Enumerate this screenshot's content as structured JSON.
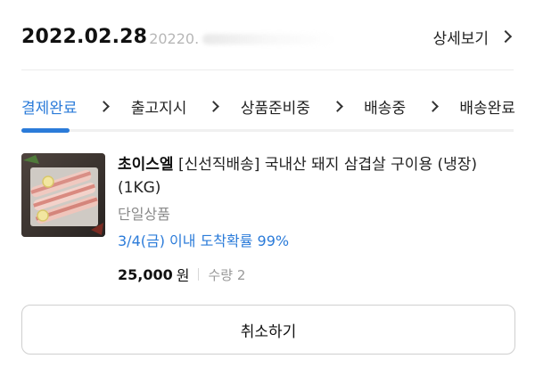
{
  "order": {
    "date": "2022.02.28",
    "number_visible": "20220."
  },
  "header": {
    "details_label": "상세보기"
  },
  "status_steps": [
    {
      "label": "결제완료",
      "active": true
    },
    {
      "label": "출고지시",
      "active": false
    },
    {
      "label": "상품준비중",
      "active": false
    },
    {
      "label": "배송중",
      "active": false
    },
    {
      "label": "배송완료",
      "active": false
    }
  ],
  "product": {
    "brand": "초이스엘",
    "name": " [신선직배송] 국내산 돼지 삼겹살 구이용 (냉장) (1KG)",
    "option": "단일상품",
    "eta": "3/4(금) 이내 도착확률 99%",
    "price": "25,000",
    "currency": "원",
    "quantity": "수량 2",
    "image_icon": "pork-belly-thumbnail"
  },
  "actions": {
    "cancel_label": "취소하기"
  },
  "colors": {
    "accent": "#2b7bd9",
    "text": "#111111",
    "muted": "#8a8a8a"
  }
}
